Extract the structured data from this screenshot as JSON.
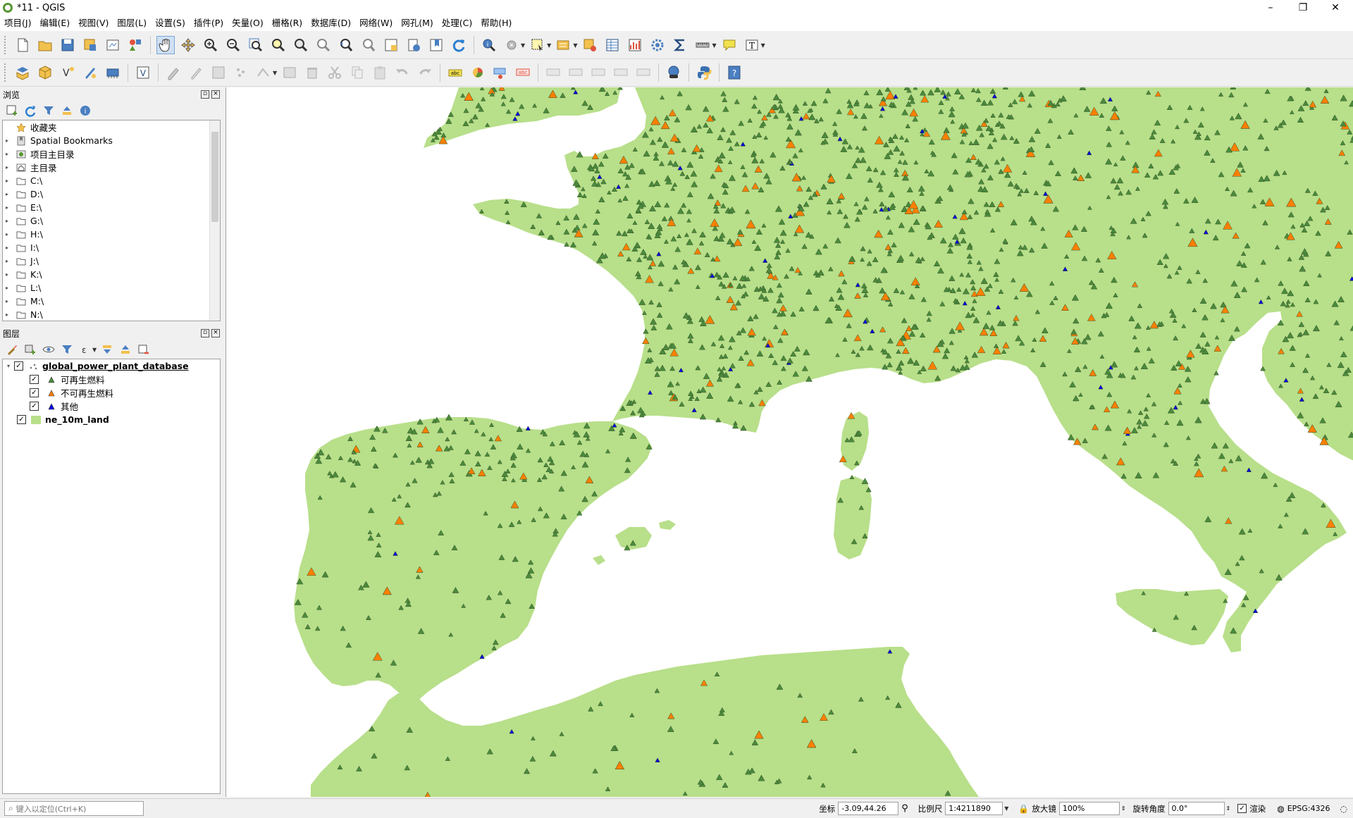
{
  "window": {
    "title": "*11 - QGIS",
    "min": "–",
    "restore": "❐",
    "close": "✕"
  },
  "menu": [
    "项目(J)",
    "编辑(E)",
    "视图(V)",
    "图层(L)",
    "设置(S)",
    "插件(P)",
    "矢量(O)",
    "栅格(R)",
    "数据库(D)",
    "网络(W)",
    "网孔(M)",
    "处理(C)",
    "帮助(H)"
  ],
  "browser": {
    "title": "浏览",
    "items": [
      {
        "label": "收藏夹",
        "icon": "star-icon",
        "arrow": ""
      },
      {
        "label": "Spatial Bookmarks",
        "icon": "bookmark-icon",
        "arrow": "▸"
      },
      {
        "label": "项目主目录",
        "icon": "project-home-icon",
        "arrow": "▸"
      },
      {
        "label": "主目录",
        "icon": "home-icon",
        "arrow": "▸"
      },
      {
        "label": "C:\\",
        "icon": "folder-icon",
        "arrow": "▸"
      },
      {
        "label": "D:\\",
        "icon": "folder-icon",
        "arrow": "▸"
      },
      {
        "label": "E:\\",
        "icon": "folder-icon",
        "arrow": "▸"
      },
      {
        "label": "G:\\",
        "icon": "folder-icon",
        "arrow": "▸"
      },
      {
        "label": "H:\\",
        "icon": "folder-icon",
        "arrow": "▸"
      },
      {
        "label": "I:\\",
        "icon": "folder-icon",
        "arrow": "▸"
      },
      {
        "label": "J:\\",
        "icon": "folder-icon",
        "arrow": "▸"
      },
      {
        "label": "K:\\",
        "icon": "folder-icon",
        "arrow": "▸"
      },
      {
        "label": "L:\\",
        "icon": "folder-icon",
        "arrow": "▸"
      },
      {
        "label": "M:\\",
        "icon": "folder-icon",
        "arrow": "▸"
      },
      {
        "label": "N:\\",
        "icon": "folder-icon",
        "arrow": "▸"
      }
    ]
  },
  "layers": {
    "title": "图层",
    "group": {
      "name": "global_power_plant_database",
      "checked": "✓"
    },
    "classes": [
      {
        "label": "可再生燃料",
        "color": "#4a8a3c",
        "checked": "✓"
      },
      {
        "label": "不可再生燃料",
        "color": "#ff7f00",
        "checked": "✓"
      },
      {
        "label": "其他",
        "color": "#0000e0",
        "checked": "✓"
      }
    ],
    "land": {
      "name": "ne_10m_land",
      "color": "#b8df8a",
      "checked": "✓"
    }
  },
  "colors": {
    "land": "#b8df8a",
    "sea": "#ffffff",
    "renewable": "#4a8a3c",
    "nonrenewable": "#ff7f00",
    "other": "#0000e0",
    "outline": "#3a5a2a"
  },
  "status": {
    "locator_placeholder": "键入以定位(Ctrl+K)",
    "coord_label": "坐标",
    "coord_value": "-3.09,44.26",
    "scale_label": "比例尺",
    "scale_value": "1:4211890",
    "magnifier_label": "放大镜",
    "magnifier_value": "100%",
    "rotation_label": "旋转角度",
    "rotation_value": "0.0°",
    "render_label": "渲染",
    "render_checked": "✓",
    "crs": "EPSG:4326"
  }
}
